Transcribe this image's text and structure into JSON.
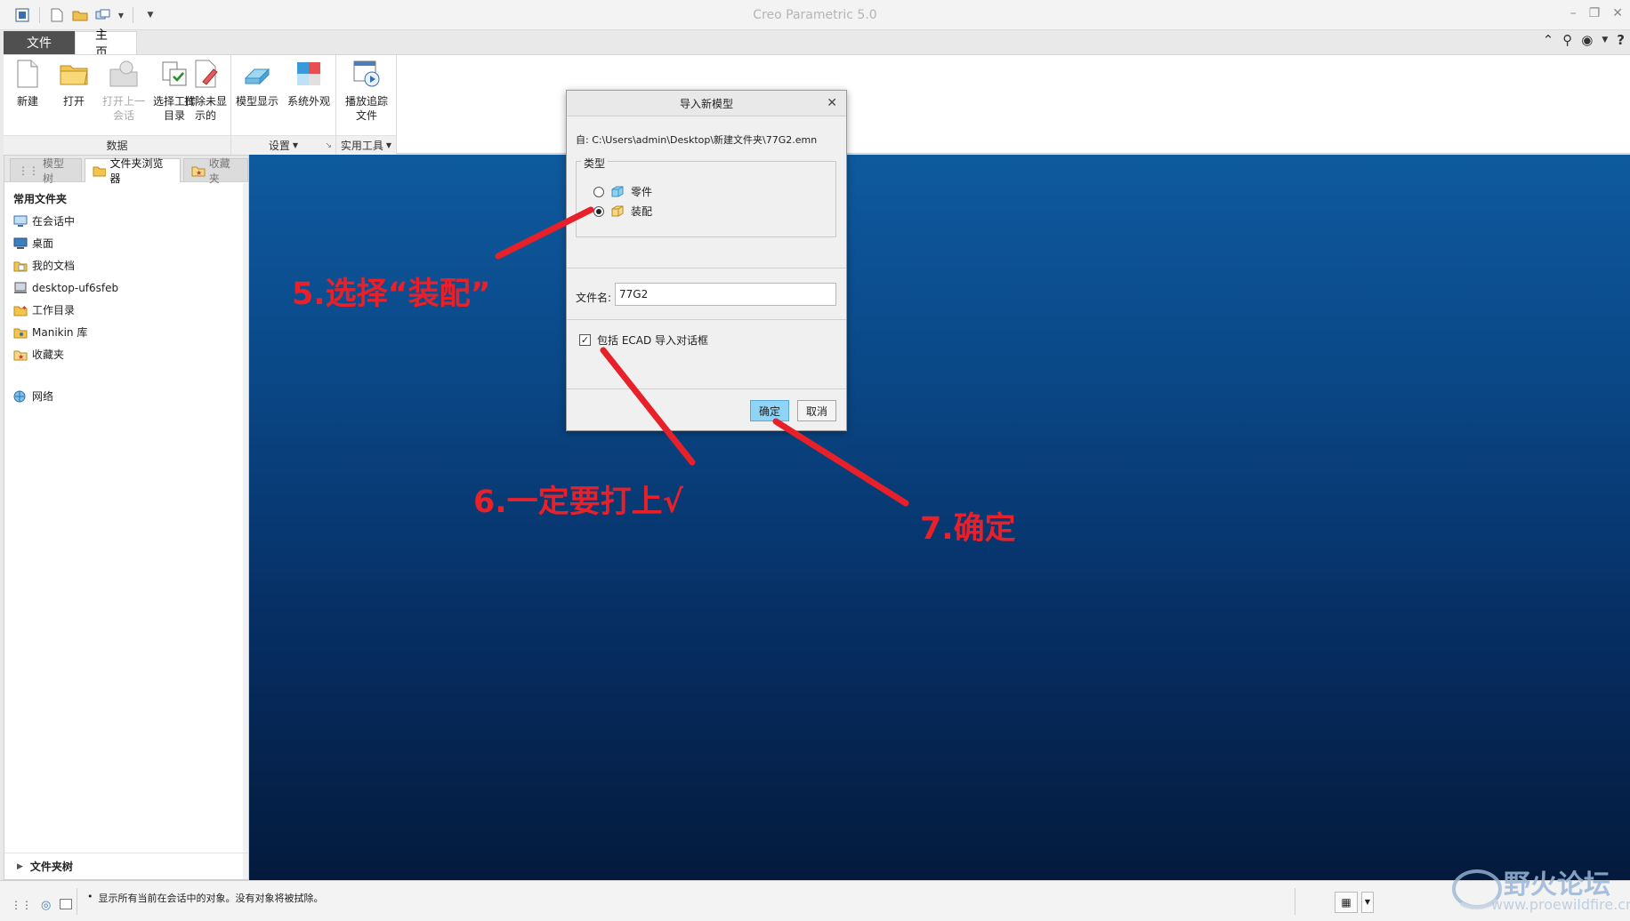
{
  "app": {
    "title": "Creo Parametric 5.0"
  },
  "ribbon": {
    "tabs": {
      "file": "文件",
      "home": "主页"
    },
    "groups": {
      "data": {
        "label": "数据",
        "new": "新建",
        "open": "打开",
        "open_last_1": "打开上一",
        "open_last_2": "会话",
        "select_wd_1": "选择工作",
        "select_wd_2": "目录",
        "erase_1": "拭除未显",
        "erase_2": "示的"
      },
      "settings": {
        "label": "设置",
        "model_display": "模型显示",
        "system_appearance": "系统外观"
      },
      "utilities": {
        "label": "实用工具",
        "playback_1": "播放追踪",
        "playback_2": "文件"
      }
    }
  },
  "navigator": {
    "tabs": {
      "model_tree": "模型树",
      "folder_browser": "文件夹浏览器",
      "favorites": "收藏夹"
    },
    "section": "常用文件夹",
    "items": [
      {
        "label": "在会话中",
        "icon": "session-icon"
      },
      {
        "label": "桌面",
        "icon": "desktop-icon"
      },
      {
        "label": "我的文档",
        "icon": "documents-icon"
      },
      {
        "label": "desktop-uf6sfeb",
        "icon": "computer-icon"
      },
      {
        "label": "工作目录",
        "icon": "working-dir-icon"
      },
      {
        "label": "Manikin 库",
        "icon": "manikin-icon"
      },
      {
        "label": "收藏夹",
        "icon": "favorites-icon"
      }
    ],
    "network": "网络",
    "folder_tree": "文件夹树"
  },
  "dialog": {
    "title": "导入新模型",
    "from": "自:  C:\\Users\\admin\\Desktop\\新建文件夹\\77G2.emn",
    "type_legend": "类型",
    "type_options": {
      "part": "零件",
      "assembly": "装配"
    },
    "type_selected": "装配",
    "file_name_label": "文件名:",
    "file_name_value": "77G2",
    "ecad_checkbox_label": "包括 ECAD 导入对话框",
    "ecad_checked": true,
    "ok": "确定",
    "cancel": "取消"
  },
  "annotations": {
    "step5": "5.选择“装配”",
    "step6": "6.一定要打上√",
    "step7": "7.确定",
    "color": "#e8202a"
  },
  "status": {
    "message": "显示所有当前在会话中的对象。没有对象将被拭除。"
  },
  "watermark": {
    "name": "野火论坛",
    "url": "www.proewildfire.cn"
  }
}
